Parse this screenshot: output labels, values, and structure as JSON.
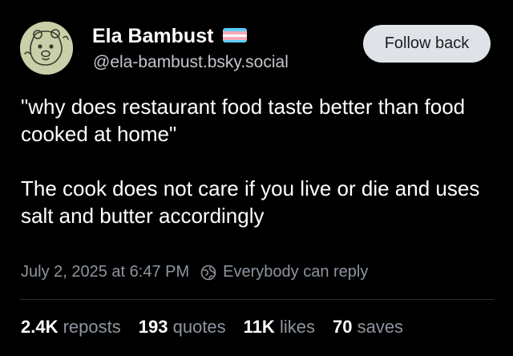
{
  "author": {
    "display_name": "Ela Bambust",
    "handle": "@ela-bambust.bsky.social",
    "flag_colors": [
      "#5bcefa",
      "#f5a9b8",
      "#ffffff",
      "#f5a9b8",
      "#5bcefa"
    ]
  },
  "follow_button": {
    "label": "Follow back"
  },
  "post": {
    "paragraphs": [
      "\"why does restaurant food taste better than food cooked at home\"",
      "The cook does not care if you live or die and uses salt and butter accordingly"
    ],
    "timestamp": "July 2, 2025 at 6:47 PM",
    "reply_setting": "Everybody can reply",
    "reply_setting_icon": "globe-icon"
  },
  "stats": {
    "reposts": {
      "count": "2.4K",
      "label": "reposts"
    },
    "quotes": {
      "count": "193",
      "label": "quotes"
    },
    "likes": {
      "count": "11K",
      "label": "likes"
    },
    "saves": {
      "count": "70",
      "label": "saves"
    }
  },
  "colors": {
    "background": "#000000",
    "text": "#ffffff",
    "muted": "#8e959e",
    "button_bg": "#dfe3e8"
  }
}
